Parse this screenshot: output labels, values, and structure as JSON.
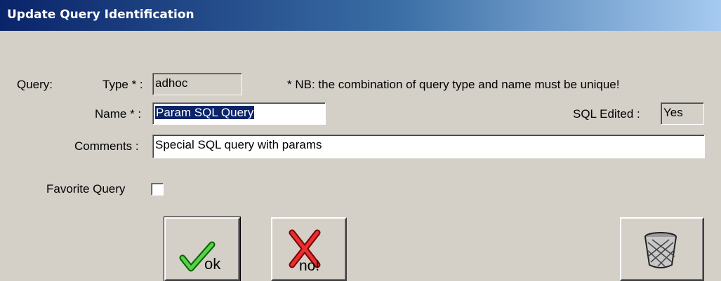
{
  "window": {
    "title": "Update Query Identification"
  },
  "form": {
    "query_label": "Query:",
    "type_label": "Type * :",
    "type_value": "adhoc",
    "note": "* NB:  the combination of query type and name must be unique!",
    "name_label": "Name * :",
    "name_value": "Param SQL Query",
    "sql_edited_label": "SQL Edited :",
    "sql_edited_value": "Yes",
    "comments_label": "Comments :",
    "comments_value": "Special SQL query with params",
    "favorite_label": "Favorite Query",
    "favorite_checked": false
  },
  "buttons": {
    "ok_label": "ok",
    "cancel_label": "no!"
  },
  "icons": {
    "ok": "checkmark-icon",
    "cancel": "red-x-icon",
    "delete": "trash-can-icon"
  },
  "colors": {
    "title_start": "#0a246a",
    "title_end": "#a6caf0",
    "face": "#d4d0c8",
    "selection": "#0a246a"
  }
}
